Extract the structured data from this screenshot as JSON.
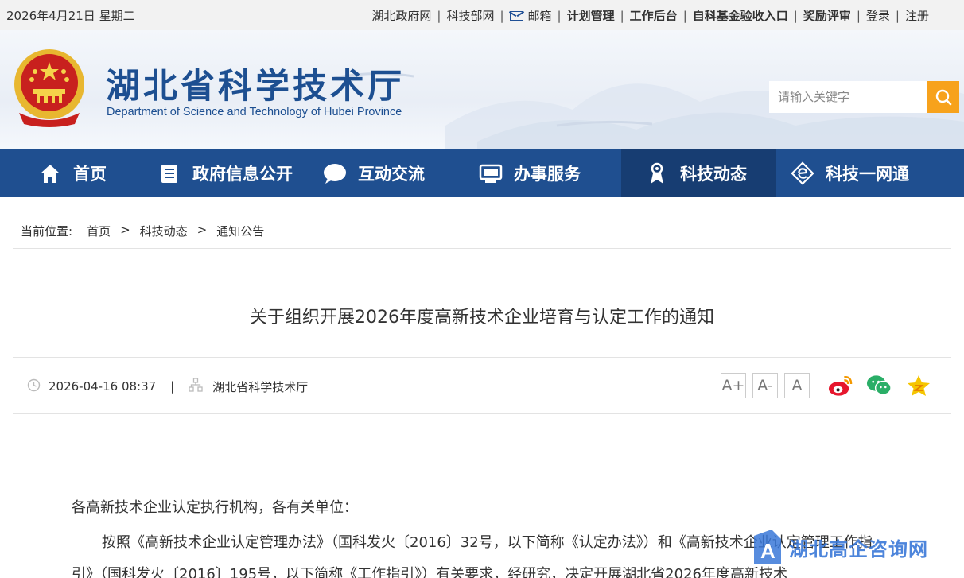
{
  "topbar": {
    "date": "2026年4月21日 星期二",
    "links": [
      {
        "label": "湖北政府网",
        "bold": false
      },
      {
        "label": "科技部网",
        "bold": false
      },
      {
        "label": "邮箱",
        "bold": false,
        "icon": "mail-icon"
      },
      {
        "label": "计划管理",
        "bold": true
      },
      {
        "label": "工作后台",
        "bold": true
      },
      {
        "label": "自科基金验收入口",
        "bold": true
      },
      {
        "label": "奖励评审",
        "bold": true
      },
      {
        "label": "登录",
        "bold": false
      },
      {
        "label": "注册",
        "bold": false
      }
    ]
  },
  "header": {
    "title": "湖北省科学技术厅",
    "subtitle": "Department of Science and Technology of Hubei Province",
    "search_placeholder": "请输入关键字",
    "brand_color": "#1d4f91",
    "search_button_color": "#f7a21c"
  },
  "nav": {
    "items": [
      {
        "label": "首页",
        "icon": "home-icon"
      },
      {
        "label": "政府信息公开",
        "icon": "document-list-icon"
      },
      {
        "label": "互动交流",
        "icon": "chat-bubble-icon"
      },
      {
        "label": "办事服务",
        "icon": "monitor-icon"
      },
      {
        "label": "科技动态",
        "icon": "award-person-icon",
        "active": true
      },
      {
        "label": "科技一网通",
        "icon": "e-globe-icon"
      }
    ],
    "bg_color": "#1f4f90",
    "active_color": "#173d72"
  },
  "breadcrumb": {
    "label": "当前位置:",
    "items": [
      "首页",
      "科技动态",
      "通知公告"
    ],
    "separator": ">"
  },
  "article": {
    "title": "关于组织开展2026年度高新技术企业培育与认定工作的通知",
    "datetime": "2026-04-16 08:37",
    "divider": "|",
    "source": "湖北省科学技术厅",
    "font_sizes": [
      "A+",
      "A-",
      "A"
    ],
    "share": [
      "weibo-icon",
      "wechat-icon",
      "qzone-icon"
    ],
    "paragraphs": [
      "各高新技术企业认定执行机构，各有关单位：",
      "按照《高新技术企业认定管理办法》（国科发火〔2016〕32号，以下简称《认定办法》）和《高新技术企业认定管理工作指引》（国科发火〔2016〕195号，以下简称《工作指引》）有关要求，经研究，决定开展湖北省2026年度高新技术"
    ]
  },
  "watermark": {
    "text": "湖北高企咨询网"
  }
}
